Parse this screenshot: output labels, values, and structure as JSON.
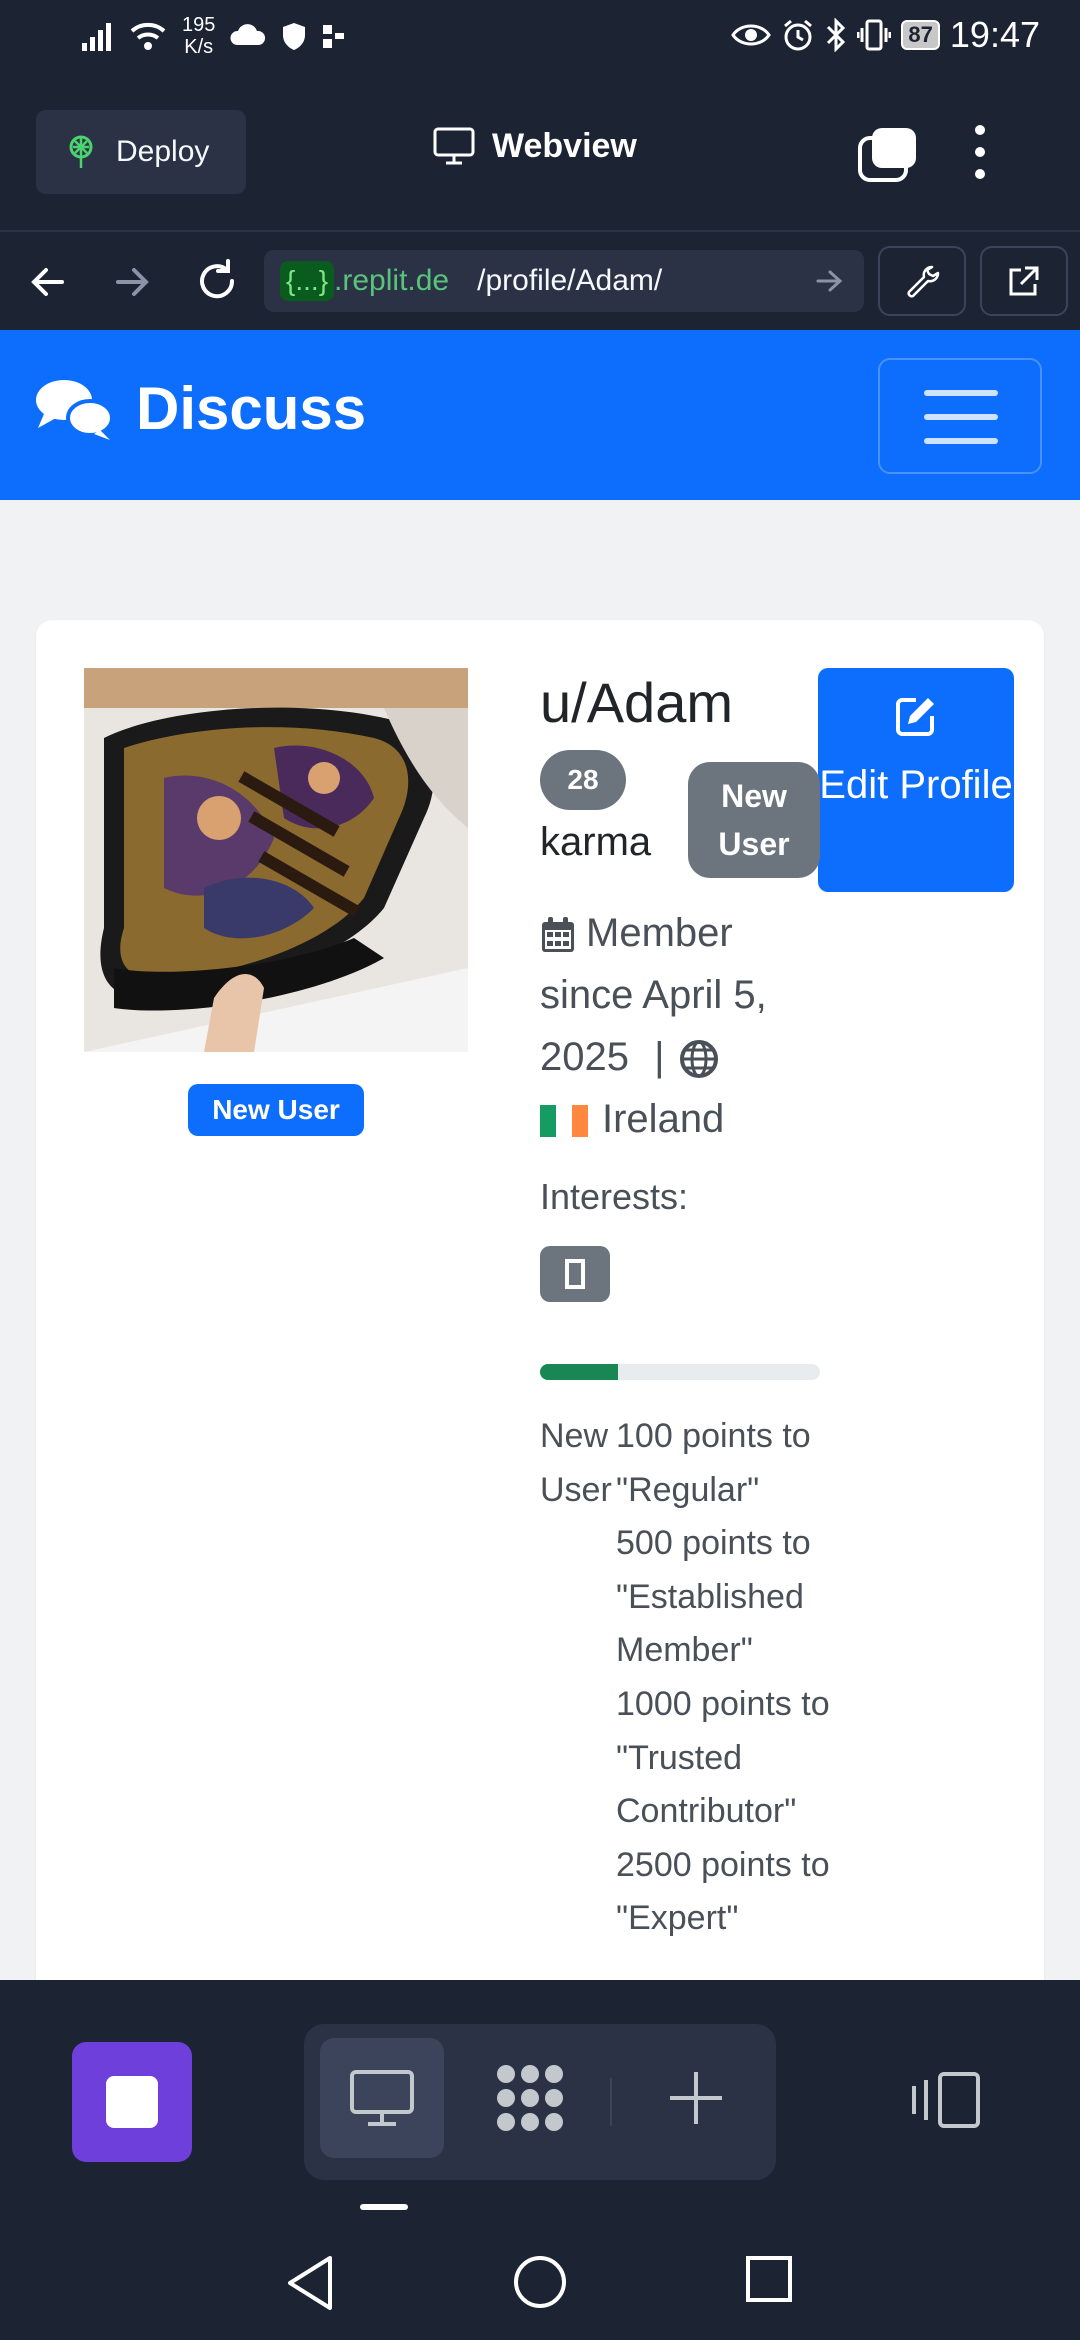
{
  "status_bar": {
    "speed_value": "195",
    "speed_unit": "K/s",
    "battery": "87",
    "time": "19:47"
  },
  "app_header": {
    "deploy_label": "Deploy",
    "title": "Webview"
  },
  "url_bar": {
    "badge": "{...}",
    "domain": ".replit.de",
    "path": "/profile/Adam/"
  },
  "site": {
    "brand": "Discuss"
  },
  "profile": {
    "username": "u/Adam",
    "karma_value": "28",
    "karma_label": "karma",
    "new_user_gray": "New User",
    "new_user_blue": "New User",
    "edit_button": "Edit Profile",
    "member_since": "Member since April 5, 2025",
    "separator": "|",
    "country": "Ireland",
    "interests_label": "Interests:",
    "progress_fraction": 0.28,
    "current_level": "New User",
    "next_levels": [
      "100 points to \"Regular\"",
      "500 points to \"Established Member\"",
      "1000 points to \"Trusted Contributor\"",
      "2500 points to \"Expert\""
    ]
  },
  "colors": {
    "primary": "#0d6efd",
    "secondary": "#6c757d",
    "success": "#198754",
    "replit_bg": "#1c2333",
    "replit_purple": "#6e3fdb"
  }
}
